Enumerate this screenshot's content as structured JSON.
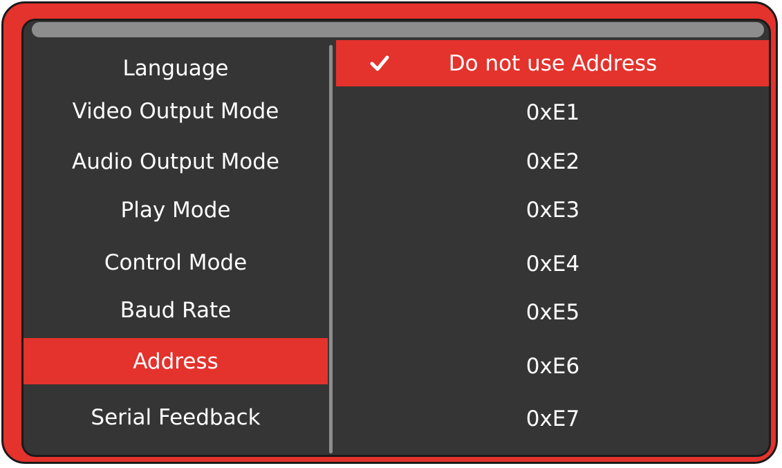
{
  "colors": {
    "frame": "#e4322c",
    "screen": "#353535",
    "highlight": "#e4322c",
    "scrollbar": "#8d8d8d",
    "text": "#ffffff"
  },
  "menu": {
    "items": [
      {
        "label": "Language"
      },
      {
        "label": "Video Output Mode"
      },
      {
        "label": "Audio Output Mode"
      },
      {
        "label": "Play Mode"
      },
      {
        "label": "Control Mode"
      },
      {
        "label": "Baud Rate"
      },
      {
        "label": "Address"
      },
      {
        "label": "Serial Feedback"
      }
    ],
    "selected_label": "Address"
  },
  "options": {
    "items": [
      {
        "label": "Do not use Address",
        "icon": "check-icon"
      },
      {
        "label": "0xE1"
      },
      {
        "label": "0xE2"
      },
      {
        "label": "0xE3"
      },
      {
        "label": "0xE4"
      },
      {
        "label": "0xE5"
      },
      {
        "label": "0xE6"
      },
      {
        "label": "0xE7"
      }
    ],
    "selected_label": "Do not use Address"
  }
}
